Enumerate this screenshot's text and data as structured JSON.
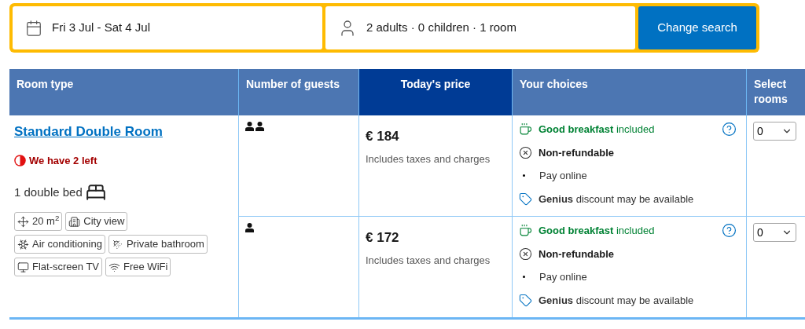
{
  "search": {
    "dates": "Fri 3 Jul - Sat 4 Jul",
    "guests": "2 adults · 0 children · 1 room",
    "button": "Change search"
  },
  "table": {
    "columns": [
      {
        "label": "Room type",
        "highlighted": false
      },
      {
        "label": "Number of guests",
        "highlighted": false
      },
      {
        "label": "Today's price",
        "highlighted": true
      },
      {
        "label": "Your choices",
        "highlighted": false
      },
      {
        "label": "Select rooms",
        "highlighted": false
      }
    ],
    "room": {
      "name": "Standard Double Room",
      "availability": "We have 2 left",
      "bed": "1 double bed",
      "facilities": [
        {
          "kind": "size",
          "label": "20 m$^{2}$"
        },
        {
          "kind": "view",
          "label": "City view"
        },
        {
          "kind": "ac",
          "label": "Air conditioning"
        },
        {
          "kind": "bathroom",
          "label": "Private bathroom"
        },
        {
          "kind": "tv",
          "label": "Flat-screen TV"
        },
        {
          "kind": "wifi",
          "label": "Free WiFi"
        }
      ]
    },
    "rates": [
      {
        "kind": "two-guests",
        "price": "€ 184",
        "price_note": "Includes taxes and charges",
        "breakfast": "**Good breakfast** included",
        "policy": "Non-refundable",
        "payment": "Pay online",
        "discount": "**Genius** discount may be available",
        "select": "0"
      },
      {
        "kind": "one-guest",
        "price": "€ 172",
        "price_note": "Includes taxes and charges",
        "breakfast": "**Good breakfast** included",
        "policy": "Non-refundable",
        "payment": "Pay online",
        "discount": "**Genius** discount may be available",
        "select": "0"
      }
    ]
  }
}
